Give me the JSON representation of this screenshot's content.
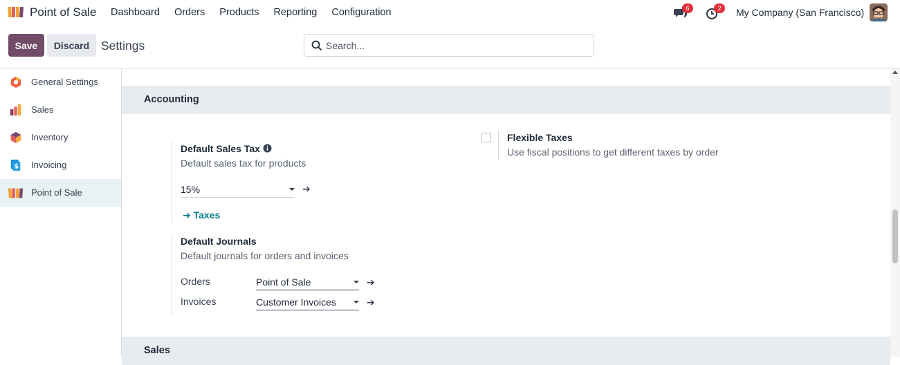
{
  "navbar": {
    "app_name": "Point of Sale",
    "menu": [
      "Dashboard",
      "Orders",
      "Products",
      "Reporting",
      "Configuration"
    ],
    "messages_count": "6",
    "activities_count": "2",
    "company": "My Company (San Francisco)"
  },
  "control_panel": {
    "save_label": "Save",
    "discard_label": "Discard",
    "title": "Settings",
    "search_placeholder": "Search..."
  },
  "sidebar": {
    "items": [
      {
        "label": "General Settings",
        "icon": "general-settings-icon"
      },
      {
        "label": "Sales",
        "icon": "sales-icon"
      },
      {
        "label": "Inventory",
        "icon": "inventory-icon"
      },
      {
        "label": "Invoicing",
        "icon": "invoicing-icon"
      },
      {
        "label": "Point of Sale",
        "icon": "point-of-sale-icon",
        "active": true
      }
    ]
  },
  "accounting": {
    "title": "Accounting",
    "default_sales_tax": {
      "title": "Default Sales Tax",
      "description": "Default sales tax for products",
      "value": "15%",
      "link": "Taxes"
    },
    "flexible_taxes": {
      "title": "Flexible Taxes",
      "description": "Use fiscal positions to get different taxes by order",
      "checked": false
    },
    "default_journals": {
      "title": "Default Journals",
      "description": "Default journals for orders and invoices",
      "orders_label": "Orders",
      "orders_value": "Point of Sale",
      "invoices_label": "Invoices",
      "invoices_value": "Customer Invoices"
    }
  },
  "sales_section": {
    "title": "Sales"
  },
  "colors": {
    "brand": "#714b67",
    "link": "#017e84",
    "badge": "#e0303b",
    "active_bg": "#e6f2f3",
    "section_bg": "#e9ecef"
  }
}
